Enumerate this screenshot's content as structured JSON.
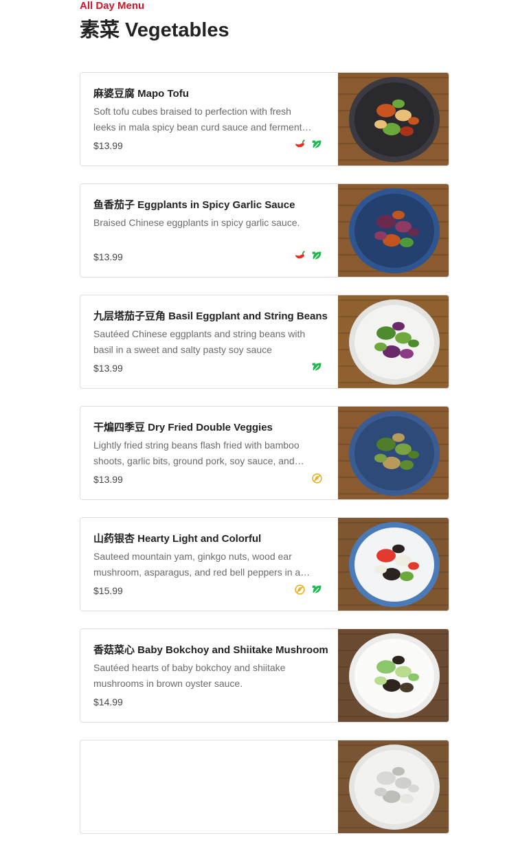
{
  "header": {
    "menu_label": "All Day Menu",
    "section_title": "素菜 Vegetables"
  },
  "colors": {
    "accent": "#d0152a",
    "spicy": "#e1312a",
    "vegetarian": "#1fb84f",
    "gluten_free": "#e4ac16"
  },
  "items": [
    {
      "name": "麻婆豆腐 Mapo Tofu",
      "description": "Soft tofu cubes braised to perfection with fresh leeks in mala spicy bean curd sauce and fermented black beans.",
      "price": "$13.99",
      "tags": [
        "spicy-icon",
        "vegetarian-icon"
      ],
      "photo": {
        "plate": "#2a2a2e",
        "rim": "#3a3a40",
        "food": [
          "#c8551f",
          "#e8c07a",
          "#6aa83a",
          "#a8331a"
        ],
        "bg": "#8a5a30"
      }
    },
    {
      "name": "鱼香茄子 Eggplants in Spicy Garlic Sauce",
      "description": "Braised Chinese eggplants in spicy garlic sauce.",
      "price": "$13.99",
      "tags": [
        "spicy-icon",
        "vegetarian-icon"
      ],
      "photo": {
        "plate": "#24406e",
        "rim": "#2f5590",
        "food": [
          "#6a2a4e",
          "#8e3a62",
          "#c2541f",
          "#4f9a3a"
        ],
        "bg": "#8a5a30"
      }
    },
    {
      "name": "九层塔茄子豆角 Basil Eggplant and String Beans",
      "description": "Sautéed Chinese eggplants and string beans with basil in a sweet and salty pasty soy sauce",
      "price": "$13.99",
      "tags": [
        "vegetarian-icon"
      ],
      "photo": {
        "plate": "#f3f3f1",
        "rim": "#e2e2df",
        "food": [
          "#4e8a2e",
          "#6fa83c",
          "#6a2a6a",
          "#8a3b84"
        ],
        "bg": "#8f6030"
      }
    },
    {
      "name": "干煸四季豆 Dry Fried Double Veggies",
      "description": "Lightly fried string beans flash fried with bamboo shoots, garlic bits, ground pork, soy sauce, and dried chili peppers.",
      "price": "$13.99",
      "tags": [
        "gluten-free-icon"
      ],
      "photo": {
        "plate": "#2d4a78",
        "rim": "#3a5c92",
        "food": [
          "#4f7d2a",
          "#7aa142",
          "#b89a5a",
          "#5e8a30"
        ],
        "bg": "#8a5a30"
      }
    },
    {
      "name": "山药银杏 Hearty Light and Colorful",
      "description": "Sauteed mountain yam, ginkgo nuts, wood ear mushroom, asparagus, and red bell peppers in a light sauce.",
      "price": "$15.99",
      "tags": [
        "gluten-free-icon",
        "vegetarian-icon"
      ],
      "photo": {
        "plate": "#f2f4f6",
        "rim": "#4a7ab8",
        "food": [
          "#e23a2e",
          "#f0ede2",
          "#2a2320",
          "#6aa83a"
        ],
        "bg": "#7e5630"
      }
    },
    {
      "name": "香菇菜心 Baby Bokchoy and Shiitake Mushroom",
      "description": "Sautéed hearts of baby bokchoy and shiitake mushrooms in brown oyster sauce.",
      "price": "$14.99",
      "tags": [],
      "photo": {
        "plate": "#fbfbf9",
        "rim": "#ececea",
        "food": [
          "#8cc66a",
          "#b9dc8e",
          "#2e241e",
          "#4a3a2a"
        ],
        "bg": "#6a4a30"
      }
    },
    {
      "name": "",
      "description": "",
      "price": "",
      "tags": [],
      "photo": {
        "plate": "#f2f2f0",
        "rim": "#e4e4e2",
        "food": [
          "#d8d8d4",
          "#cfcfcb",
          "#bdbdb8",
          "#e6e6e2"
        ],
        "bg": "#7a5534"
      }
    }
  ]
}
